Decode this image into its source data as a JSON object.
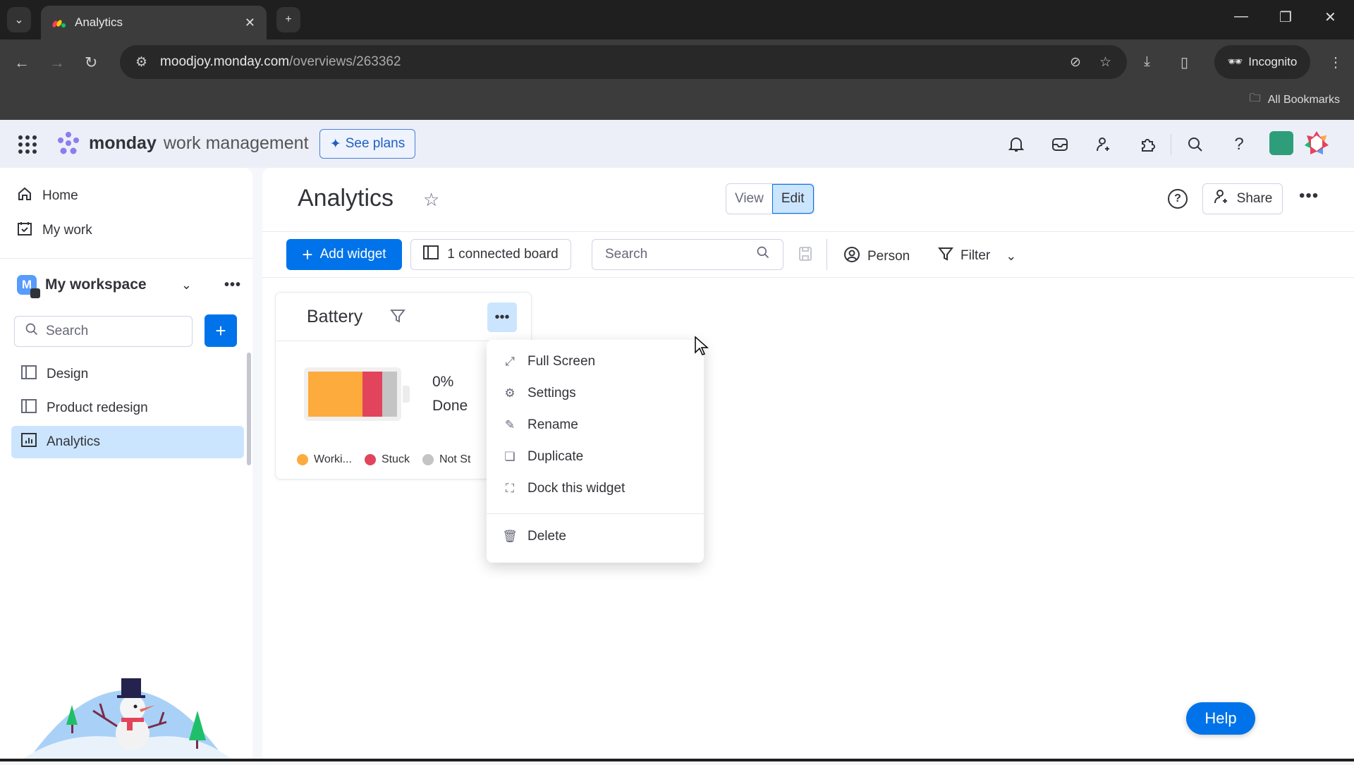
{
  "browser": {
    "tab_title": "Analytics",
    "url_host": "moodjoy.monday.com",
    "url_path": "/overviews/263362",
    "incognito_label": "Incognito",
    "bookmarks_label": "All Bookmarks"
  },
  "header": {
    "brand_bold": "monday",
    "brand_rest": "work management",
    "see_plans": "See plans",
    "icons": [
      "bell-icon",
      "inbox-icon",
      "invite-icon",
      "apps-icon",
      "search-icon",
      "help-icon"
    ]
  },
  "sidebar": {
    "nav": [
      {
        "label": "Home",
        "icon": "home-icon"
      },
      {
        "label": "My work",
        "icon": "calendar-check-icon"
      }
    ],
    "workspace": {
      "name": "My workspace",
      "initial": "M"
    },
    "search_placeholder": "Search",
    "items": [
      {
        "label": "Design",
        "icon": "board-icon",
        "active": false
      },
      {
        "label": "Product redesign",
        "icon": "board-icon",
        "active": false
      },
      {
        "label": "Analytics",
        "icon": "dashboard-icon",
        "active": true
      }
    ]
  },
  "main": {
    "title": "Analytics",
    "view_label": "View",
    "edit_label": "Edit",
    "share_label": "Share",
    "toolbar": {
      "add_widget": "Add widget",
      "connected_boards": "1 connected board",
      "search_placeholder": "Search",
      "person": "Person",
      "filter": "Filter"
    }
  },
  "widget": {
    "title": "Battery",
    "done_percent": "0%",
    "done_label": "Done",
    "segments": [
      {
        "label": "Worki...",
        "color": "#fdab3d",
        "share": 0.61
      },
      {
        "label": "Stuck",
        "color": "#e2445c",
        "share": 0.22
      },
      {
        "label": "Not St",
        "color": "#c4c4c4",
        "share": 0.17
      }
    ]
  },
  "menu": {
    "items": [
      {
        "label": "Full Screen",
        "icon": "expand-icon"
      },
      {
        "label": "Settings",
        "icon": "gear-icon"
      },
      {
        "label": "Rename",
        "icon": "pencil-icon"
      },
      {
        "label": "Duplicate",
        "icon": "duplicate-icon"
      },
      {
        "label": "Dock this widget",
        "icon": "dock-icon"
      }
    ],
    "delete": {
      "label": "Delete",
      "icon": "trash-icon"
    }
  },
  "help_button": "Help"
}
